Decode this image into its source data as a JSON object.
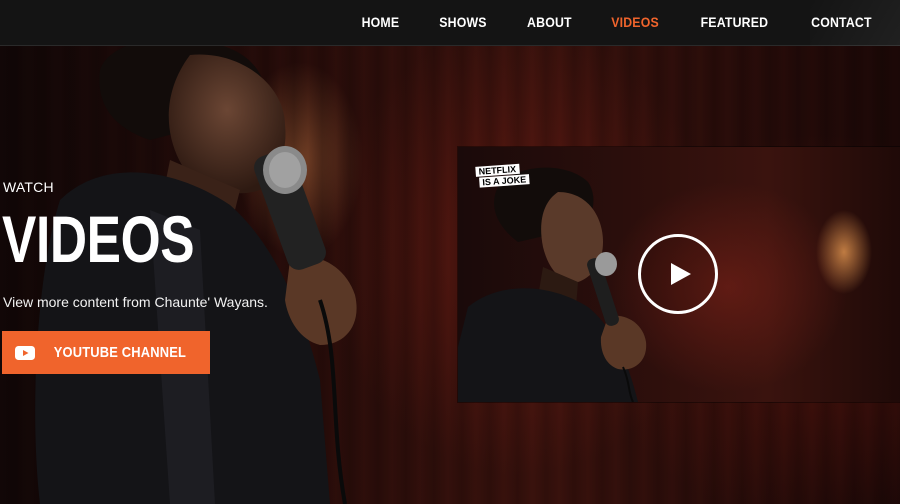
{
  "nav": {
    "items": [
      {
        "label": "HOME",
        "active": false
      },
      {
        "label": "SHOWS",
        "active": false
      },
      {
        "label": "ABOUT",
        "active": false
      },
      {
        "label": "VIDEOS",
        "active": true
      },
      {
        "label": "FEATURED",
        "active": false
      },
      {
        "label": "CONTACT",
        "active": false
      }
    ]
  },
  "hero": {
    "eyebrow": "WATCH",
    "heading": "VIDEOS",
    "subtext": "View more content from Chaunte' Wayans.",
    "button_label": "YOUTUBE CHANNEL",
    "button_icon": "youtube-icon"
  },
  "video": {
    "badge_line1": "NETFLIX",
    "badge_line2": "IS A JOKE",
    "play_icon": "play-icon"
  },
  "colors": {
    "accent": "#f0642c",
    "nav_bg": "#141414",
    "text": "#ffffff"
  }
}
